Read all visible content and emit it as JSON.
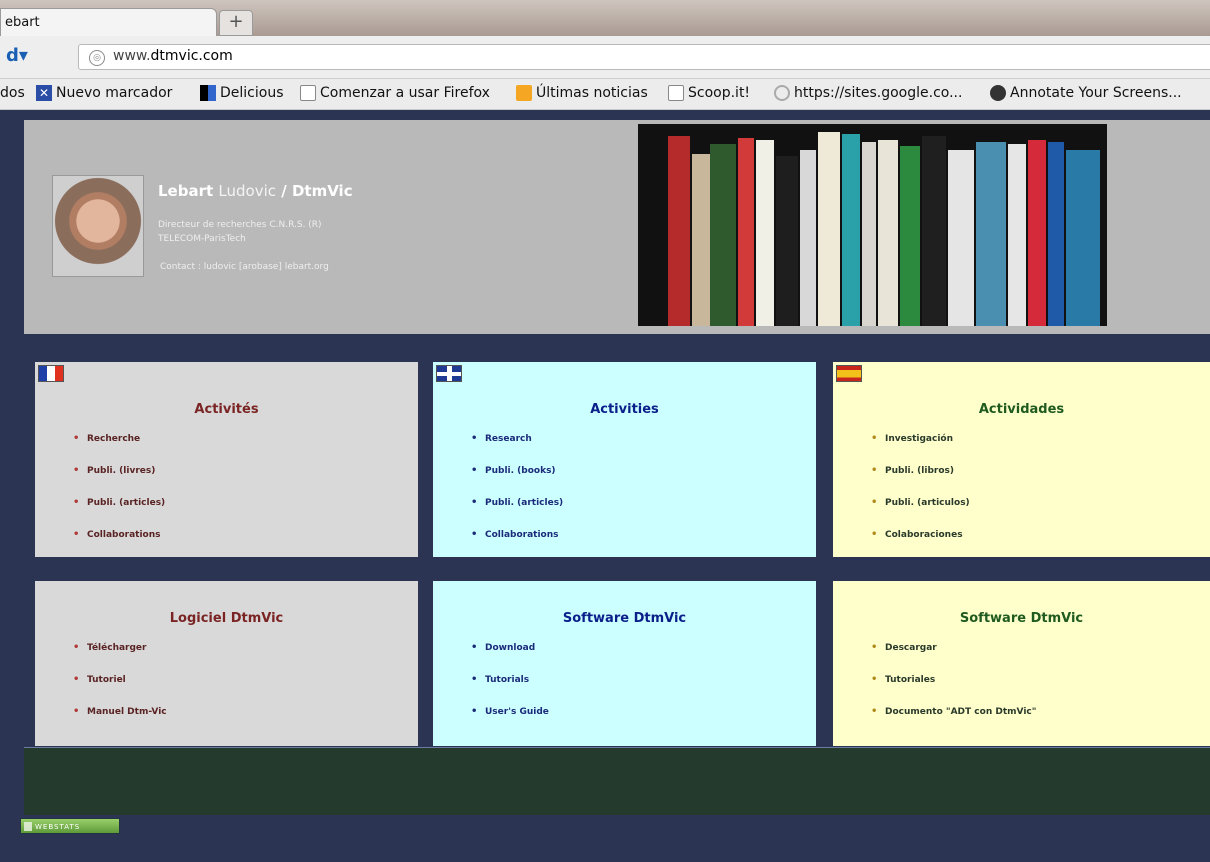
{
  "browser": {
    "tab_title": "ebart",
    "new_tab": "+",
    "url_prefix": "www.",
    "url_domain": "dtmvic.com",
    "bookmarks": [
      {
        "label": "dos",
        "icon": "none"
      },
      {
        "label": "Nuevo marcador",
        "icon": "x-icon"
      },
      {
        "label": "Delicious",
        "icon": "delicious-icon"
      },
      {
        "label": "Comenzar a usar Firefox",
        "icon": "page-icon"
      },
      {
        "label": "Últimas noticias",
        "icon": "rss-icon"
      },
      {
        "label": "Scoop.it!",
        "icon": "page-icon"
      },
      {
        "label": "https://sites.google.co...",
        "icon": "google-sites-icon"
      },
      {
        "label": "Annotate Your Screens...",
        "icon": "annotate-icon"
      }
    ]
  },
  "header": {
    "first_name_bold": "Lebart",
    "first_name": "Ludovic",
    "separator": "/",
    "brand": "DtmVic",
    "line1": "Directeur de recherches C.N.R.S. (R)",
    "line2": "TELECOM-ParisTech",
    "line3": "Contact : ludovic [arobase] lebart.org"
  },
  "activities": {
    "fr": {
      "title": "Activités",
      "items": [
        "Recherche",
        "Publi. (livres)",
        "Publi. (articles)",
        "Collaborations"
      ]
    },
    "en": {
      "title": "Activities",
      "items": [
        "Research",
        "Publi. (books)",
        "Publi. (articles)",
        "Collaborations"
      ]
    },
    "es": {
      "title": "Actividades",
      "items": [
        "Investigación",
        "Publi. (libros)",
        "Publi. (articulos)",
        "Colaboraciones"
      ]
    }
  },
  "software": {
    "fr": {
      "title": "Logiciel DtmVic",
      "items": [
        "Télécharger",
        "Tutoriel",
        "Manuel Dtm-Vic"
      ]
    },
    "en": {
      "title": "Software DtmVic",
      "items": [
        "Download",
        "Tutorials",
        "User's Guide"
      ]
    },
    "es": {
      "title": "Software DtmVic",
      "items": [
        "Descargar",
        "Tutoriales",
        "Documento \"ADT con DtmVic\""
      ]
    }
  },
  "webstats_label": "WEBSTATS",
  "colors": {
    "page_bg": "#2b3553",
    "header_bg": "#b9b9b9",
    "fr_bg": "#d9d9d9",
    "en_bg": "#ccffff",
    "es_bg": "#ffffcc",
    "footer_bg": "#243a2d"
  }
}
